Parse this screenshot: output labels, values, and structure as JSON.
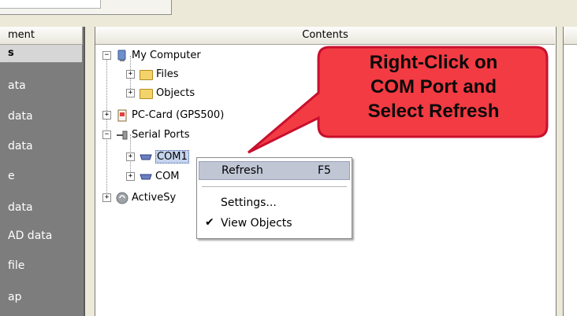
{
  "left_panel": {
    "header": "ment",
    "selected": "s",
    "items": [
      "ata",
      "data",
      "data",
      "e",
      "data",
      "AD data",
      "file",
      "ap"
    ]
  },
  "contents": {
    "header": "Contents",
    "tree": {
      "my_computer": "My Computer",
      "files": "Files",
      "objects": "Objects",
      "pc_card": "PC-Card (GPS500)",
      "serial_ports": "Serial Ports",
      "com1": "COM1",
      "com2": "COM",
      "activesync": "ActiveSy"
    }
  },
  "context_menu": {
    "refresh": "Refresh",
    "refresh_shortcut": "F5",
    "settings": "Settings...",
    "view_objects": "View Objects",
    "check_mark": "✔"
  },
  "callout": {
    "line1": "Right-Click on",
    "line2": "COM Port and",
    "line3": "Select Refresh"
  },
  "tree_expander": {
    "plus": "+",
    "minus": "−"
  },
  "colors": {
    "callout_fill": "#f23b43",
    "callout_border": "#c8102e",
    "left_panel_bg": "#7d7d7d",
    "menu_highlight": "#c0c6d4"
  }
}
